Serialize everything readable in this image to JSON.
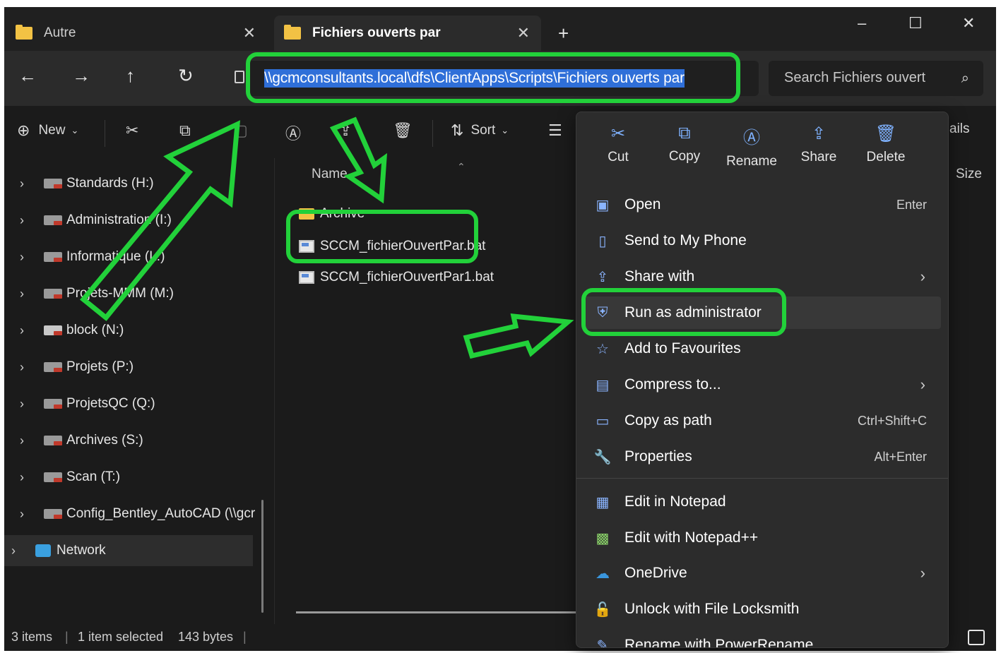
{
  "tabs": [
    {
      "label": "Autre",
      "active": false
    },
    {
      "label": "Fichiers ouverts par",
      "active": true
    }
  ],
  "window_controls": {
    "minimize": "–",
    "maximize": "☐",
    "close": "✕"
  },
  "new_tab_label": "+",
  "address": {
    "path": "\\\\gcmconsultants.local\\dfs\\ClientApps\\Scripts\\Fichiers ouverts par"
  },
  "search": {
    "placeholder": "Search Fichiers ouvert"
  },
  "commands": {
    "new": "New",
    "sort": "Sort",
    "details_fragment": "ails"
  },
  "sidebar": {
    "drives": [
      {
        "label": "Standards (H:)"
      },
      {
        "label": "Administration (I:)"
      },
      {
        "label": "Informatique (L:)"
      },
      {
        "label": "Projets-MMM (M:)"
      },
      {
        "label": "block (N:)"
      },
      {
        "label": "Projets (P:)"
      },
      {
        "label": "ProjetsQC (Q:)"
      },
      {
        "label": "Archives (S:)"
      },
      {
        "label": "Scan (T:)"
      },
      {
        "label": "Config_Bentley_AutoCAD (\\\\gcr"
      }
    ],
    "network": "Network"
  },
  "filelist": {
    "columns": {
      "name": "Name",
      "size": "Size"
    },
    "files": [
      {
        "name": "Archive",
        "type": "folder"
      },
      {
        "name": "SCCM_fichierOuvertPar.bat",
        "type": "bat"
      },
      {
        "name": "SCCM_fichierOuvertPar1.bat",
        "type": "bat"
      }
    ]
  },
  "status": {
    "items": "3 items",
    "selected": "1 item selected",
    "size": "143 bytes"
  },
  "context_menu": {
    "quick_actions": [
      {
        "label": "Cut",
        "icon": "scissors-icon"
      },
      {
        "label": "Copy",
        "icon": "copy-icon"
      },
      {
        "label": "Rename",
        "icon": "rename-icon"
      },
      {
        "label": "Share",
        "icon": "share-icon"
      },
      {
        "label": "Delete",
        "icon": "trash-icon"
      }
    ],
    "items": [
      {
        "label": "Open",
        "shortcut": "Enter"
      },
      {
        "label": "Send to My Phone",
        "shortcut": ""
      },
      {
        "label": "Share with",
        "shortcut": ""
      },
      {
        "label": "Run as administrator",
        "shortcut": ""
      },
      {
        "label": "Add to Favourites",
        "shortcut": ""
      },
      {
        "label": "Compress to...",
        "shortcut": ""
      },
      {
        "label": "Copy as path",
        "shortcut": "Ctrl+Shift+C"
      },
      {
        "label": "Properties",
        "shortcut": "Alt+Enter"
      },
      {
        "label": "Edit in Notepad",
        "shortcut": ""
      },
      {
        "label": "Edit with Notepad++",
        "shortcut": ""
      },
      {
        "label": "OneDrive",
        "shortcut": ""
      },
      {
        "label": "Unlock with File Locksmith",
        "shortcut": ""
      },
      {
        "label": "Rename with PowerRename",
        "shortcut": ""
      }
    ]
  },
  "colors": {
    "annotation": "#22d13a",
    "selection": "#2f6fd8",
    "background": "#1b1b1b"
  }
}
